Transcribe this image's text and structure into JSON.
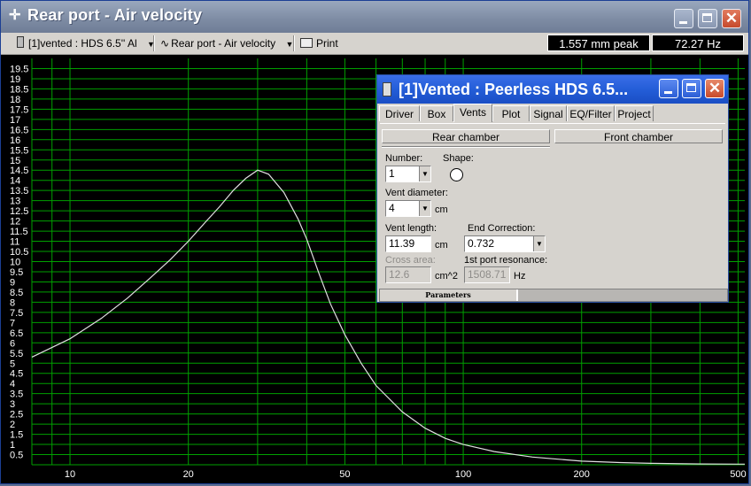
{
  "window": {
    "title": "Rear port - Air velocity",
    "title_icon": "crosshair-icon"
  },
  "toolbar": {
    "project": "[1]vented : HDS 6.5'' Al",
    "plot": "Rear port - Air velocity",
    "print": "Print",
    "readout_excursion": "1.557 mm peak",
    "readout_freq": "72.27 Hz"
  },
  "chart_data": {
    "type": "line",
    "x_scale": "log",
    "xlim": [
      8,
      520
    ],
    "ylim": [
      0,
      20
    ],
    "x_ticks": [
      10,
      20,
      50,
      100,
      200,
      500
    ],
    "x_tick_labels": [
      "10",
      "20",
      "50",
      "100",
      "200",
      "500"
    ],
    "y_ticks": [
      0.5,
      1,
      1.5,
      2,
      2.5,
      3,
      3.5,
      4,
      4.5,
      5,
      5.5,
      6,
      6.5,
      7,
      7.5,
      8,
      8.5,
      9,
      9.5,
      10,
      10.5,
      11,
      11.5,
      12,
      12.5,
      13,
      13.5,
      14,
      14.5,
      15,
      15.5,
      16,
      16.5,
      17,
      17.5,
      18,
      18.5,
      19,
      19.5
    ],
    "y_tick_labels": [
      "0.5",
      "1",
      "1.5",
      "2",
      "2.5",
      "3",
      "3.5",
      "4",
      "4.5",
      "5",
      "5.5",
      "6",
      "6.5",
      "7",
      "7.5",
      "8",
      "8.5",
      "9",
      "9.5",
      "10",
      "10.5",
      "11",
      "11.5",
      "12",
      "12.5",
      "13",
      "13.5",
      "14",
      "14.5",
      "15",
      "15.5",
      "16",
      "16.5",
      "17",
      "17.5",
      "18",
      "18.5",
      "19",
      "19.5"
    ],
    "grid": true,
    "background": "#000000",
    "grid_color": "#00a000",
    "line_color": "#e0e0e0",
    "tick_color": "#ffffff",
    "series": [
      {
        "x": [
          8,
          10,
          12,
          14,
          16,
          18,
          20,
          22,
          24,
          26,
          28,
          30,
          32,
          35,
          38,
          40,
          43,
          46,
          50,
          55,
          60,
          70,
          80,
          90,
          100,
          120,
          150,
          200,
          250,
          300,
          400,
          500,
          520
        ],
        "y": [
          5.3,
          6.2,
          7.2,
          8.2,
          9.2,
          10.1,
          11.0,
          11.9,
          12.7,
          13.5,
          14.1,
          14.5,
          14.3,
          13.4,
          12.1,
          11.1,
          9.4,
          7.9,
          6.4,
          5.0,
          3.9,
          2.6,
          1.8,
          1.3,
          1.0,
          0.65,
          0.38,
          0.18,
          0.11,
          0.07,
          0.04,
          0.03,
          0.03
        ]
      }
    ]
  },
  "dialog": {
    "title": "[1]Vented : Peerless HDS 6.5...",
    "tabs": [
      "Driver",
      "Box",
      "Vents",
      "Plot",
      "Signal",
      "EQ/Filter",
      "Project"
    ],
    "active_tab": "Vents",
    "rear_chamber": "Rear chamber",
    "front_chamber": "Front chamber",
    "number_label": "Number:",
    "number_value": "1",
    "shape_label": "Shape:",
    "vent_diameter_label": "Vent diameter:",
    "vent_diameter_value": "4",
    "cm_unit": "cm",
    "vent_length_label": "Vent length:",
    "vent_length_value": "11.39",
    "end_correction_label": "End Correction:",
    "end_correction_value": "0.732",
    "cross_area_label": "Cross area:",
    "cross_area_value": "12.6",
    "cross_area_unit": "cm^2",
    "resonance_label": "1st port resonance:",
    "resonance_value": "1508.71",
    "hz_unit": "Hz",
    "status_panel": "Parameters"
  }
}
